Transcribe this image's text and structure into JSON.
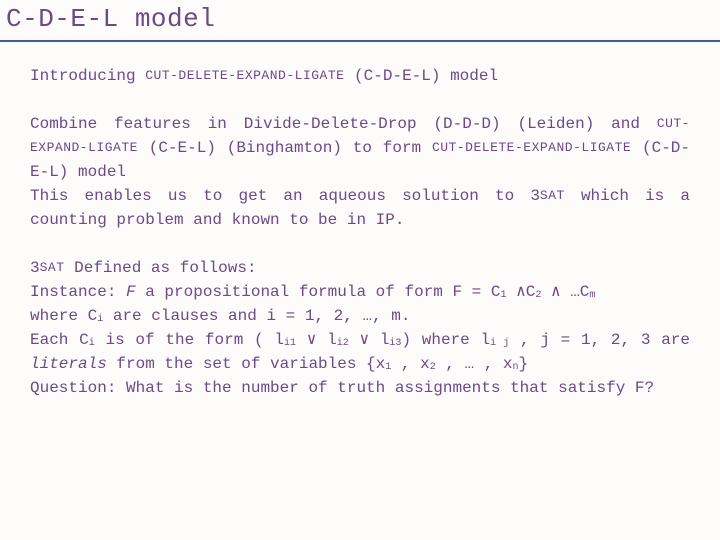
{
  "title": "C-D-E-L model",
  "intro": {
    "prefix": "Introducing ",
    "sc1": "CUT-DELETE-EXPAND-LIGATE",
    "suffix": " (C-D-E-L) model"
  },
  "p1": {
    "t1": "Combine features in Divide-Delete-Drop (D-D-D) (Leiden) and ",
    "sc1": "CUT-EXPAND-LIGATE",
    "t2": " (C-E-L) (Binghamton) to form ",
    "sc2": "CUT-DELETE-EXPAND-LIGATE",
    "t3": " (C-D-E-L) model",
    "t4": "This enables us to get an aqueous solution to 3",
    "sc3": "SAT",
    "t5": " which is a counting problem and known to be in IP."
  },
  "p2": {
    "l1a": "3",
    "l1sc": "SAT",
    "l1b": " Defined as follows:",
    "l2a": "Instance: ",
    "l2F": "F",
    "l2b": " a propositional formula of form F =  C",
    "l2s1": "1",
    "l2c": " ∧C",
    "l2s2": "2",
    "l2d": " ∧ …C",
    "l2s3": "m",
    "l3a": "where C",
    "l3s1": "i",
    "l3b": " are clauses and i = 1, 2, …, m.",
    "l4a": "Each C",
    "l4s1": "i",
    "l4b": " is of the form ( l",
    "l4s2": "i1",
    "l4c": " ∨ l",
    "l4s3": "i2",
    "l4d": " ∨ l",
    "l4s4": "i3",
    "l4e": ") where  l",
    "l4s5": "i j",
    "l4f": " , j = 1, 2, 3 are ",
    "l4lit": "literals",
    "l4g": " from the set of variables {x",
    "l4s6": "1",
    "l4h": " , x",
    "l4s7": "2",
    "l4i": " , … , x",
    "l4s8": "n",
    "l4j": "}",
    "l5": "Question: What is the number of truth assignments that satisfy F?"
  }
}
